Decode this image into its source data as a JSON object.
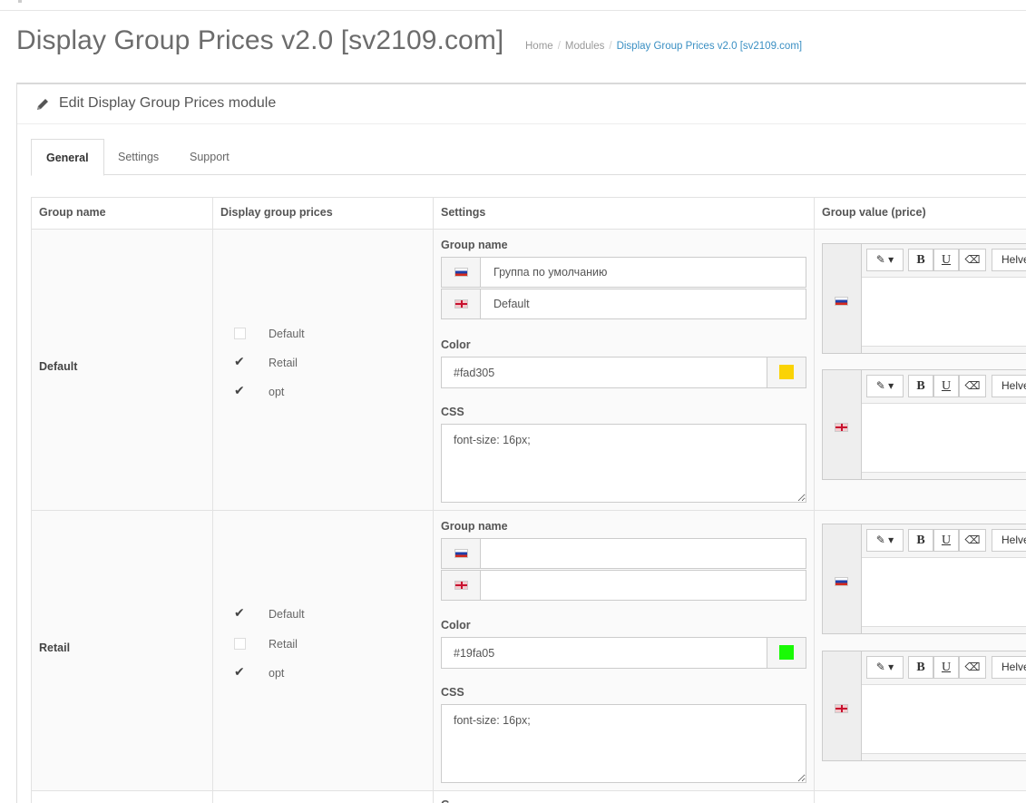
{
  "page": {
    "title": "Display Group Prices v2.0 [sv2109.com]",
    "breadcrumb": [
      "Home",
      "Modules",
      "Display Group Prices v2.0 [sv2109.com]"
    ]
  },
  "panel": {
    "title": "Edit Display Group Prices module",
    "icon": "pencil-icon"
  },
  "tabs": [
    {
      "label": "General",
      "active": true
    },
    {
      "label": "Settings",
      "active": false
    },
    {
      "label": "Support",
      "active": false
    }
  ],
  "table": {
    "headers": [
      "Group name",
      "Display group prices",
      "Settings",
      "Group value (price)"
    ],
    "settings_labels": {
      "group_name": "Group name",
      "color": "Color",
      "css": "CSS"
    },
    "rows": [
      {
        "group": "Default",
        "checks": [
          {
            "label": "Default",
            "checked": false
          },
          {
            "label": "Retail",
            "checked": true
          },
          {
            "label": "opt",
            "checked": true
          }
        ],
        "names": {
          "ru": "Группа по умолчанию",
          "en": "Default"
        },
        "color": "#fad305",
        "css": "font-size: 16px;"
      },
      {
        "group": "Retail",
        "checks": [
          {
            "label": "Default",
            "checked": true
          },
          {
            "label": "Retail",
            "checked": false
          },
          {
            "label": "opt",
            "checked": true
          }
        ],
        "names": {
          "ru": "",
          "en": ""
        },
        "color": "#19fa05",
        "css": "font-size: 16px;"
      }
    ],
    "next_row_partial_label": "G"
  },
  "editor_toolbar": {
    "font_label": "Helve",
    "buttons": [
      "magic-icon",
      "bold-icon",
      "underline-icon",
      "eraser-icon"
    ]
  },
  "colors": {
    "accent": "#3a8fc3",
    "swatch_default": "#fad305",
    "swatch_retail": "#19fa05"
  }
}
